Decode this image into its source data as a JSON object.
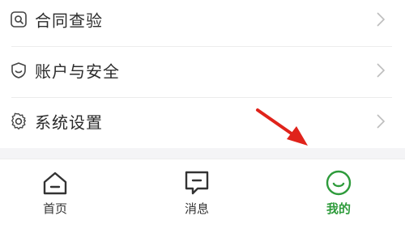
{
  "menu": {
    "items": [
      {
        "label": "合同查验",
        "icon": "contract-search-icon"
      },
      {
        "label": "账户与安全",
        "icon": "shield-icon"
      },
      {
        "label": "系统设置",
        "icon": "gear-icon"
      }
    ]
  },
  "tabbar": {
    "tabs": [
      {
        "label": "首页",
        "icon": "home-icon",
        "active": false
      },
      {
        "label": "消息",
        "icon": "message-icon",
        "active": false
      },
      {
        "label": "我的",
        "icon": "profile-smile-icon",
        "active": true
      }
    ]
  },
  "colors": {
    "accent": "#2e9b3b",
    "annotation_arrow": "#e0231b",
    "text": "#2b2b2b",
    "chevron": "#bdbdbd"
  }
}
